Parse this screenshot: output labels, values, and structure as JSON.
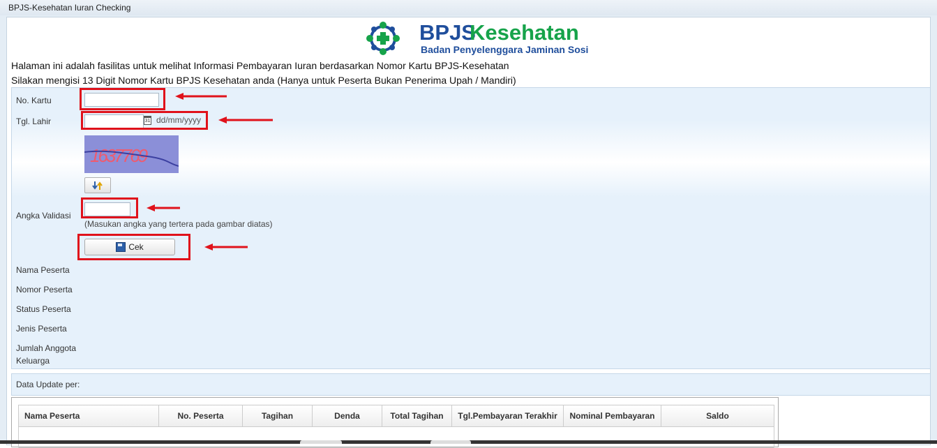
{
  "window": {
    "title": "BPJS-Kesehatan Iuran Checking"
  },
  "logo": {
    "brand_prefix": "BPJS",
    "brand_suffix": "Kesehatan",
    "tagline": "Badan Penyelenggara Jaminan Sosial"
  },
  "intro": {
    "line1": "Halaman ini adalah fasilitas untuk melihat Informasi Pembayaran Iuran berdasarkan Nomor Kartu BPJS-Kesehatan",
    "line2": "Silakan mengisi 13 Digit Nomor Kartu BPJS Kesehatan anda (Hanya untuk Peserta Bukan Penerima Upah / Mandiri)"
  },
  "form": {
    "no_kartu_label": "No. Kartu",
    "no_kartu_value": "",
    "tgl_lahir_label": "Tgl. Lahir",
    "tgl_lahir_value": "",
    "tgl_lahir_format": "dd/mm/yyyy",
    "calendar_icon_text": "31",
    "captcha_text": "1637769",
    "angka_validasi_label": "Angka Validasi",
    "angka_validasi_value": "",
    "angka_validasi_hint": "(Masukan angka yang tertera pada gambar diatas)",
    "cek_label": "Cek"
  },
  "info": {
    "nama_peserta": "Nama Peserta",
    "nomor_peserta": "Nomor Peserta",
    "status_peserta": "Status Peserta",
    "jenis_peserta": "Jenis Peserta",
    "jumlah_anggota_1": "Jumlah Anggota",
    "jumlah_anggota_2": "Keluarga"
  },
  "update": {
    "label": "Data Update per:"
  },
  "table": {
    "columns": [
      "Nama Peserta",
      "No. Peserta",
      "Tagihan",
      "Denda",
      "Total Tagihan",
      "Tgl.Pembayaran Terakhir",
      "Nominal Pembayaran",
      "Saldo"
    ]
  },
  "colors": {
    "highlight": "#e0121b",
    "brand_blue": "#1f4e9c",
    "brand_green": "#16a34a",
    "panel": "#e6f1fb"
  }
}
